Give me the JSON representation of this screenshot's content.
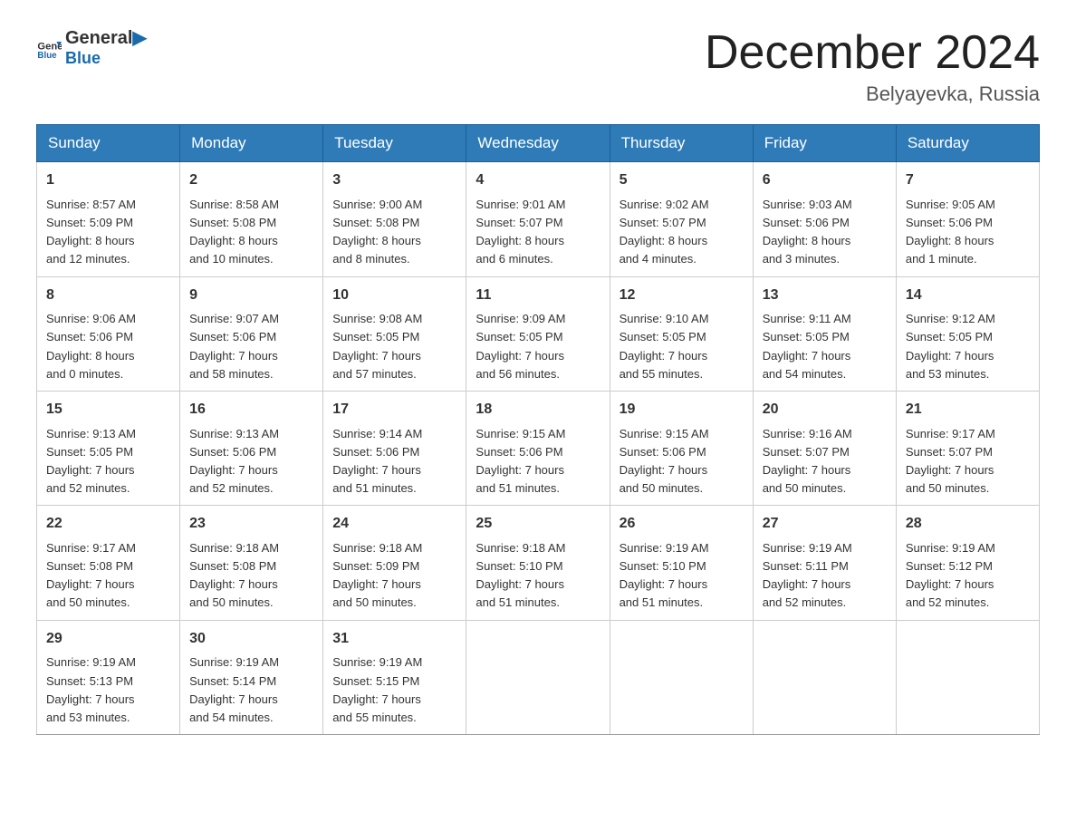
{
  "logo": {
    "text_general": "General",
    "text_blue": "Blue"
  },
  "title": "December 2024",
  "location": "Belyayevka, Russia",
  "days_of_week": [
    "Sunday",
    "Monday",
    "Tuesday",
    "Wednesday",
    "Thursday",
    "Friday",
    "Saturday"
  ],
  "weeks": [
    [
      {
        "day": "1",
        "info": "Sunrise: 8:57 AM\nSunset: 5:09 PM\nDaylight: 8 hours\nand 12 minutes."
      },
      {
        "day": "2",
        "info": "Sunrise: 8:58 AM\nSunset: 5:08 PM\nDaylight: 8 hours\nand 10 minutes."
      },
      {
        "day": "3",
        "info": "Sunrise: 9:00 AM\nSunset: 5:08 PM\nDaylight: 8 hours\nand 8 minutes."
      },
      {
        "day": "4",
        "info": "Sunrise: 9:01 AM\nSunset: 5:07 PM\nDaylight: 8 hours\nand 6 minutes."
      },
      {
        "day": "5",
        "info": "Sunrise: 9:02 AM\nSunset: 5:07 PM\nDaylight: 8 hours\nand 4 minutes."
      },
      {
        "day": "6",
        "info": "Sunrise: 9:03 AM\nSunset: 5:06 PM\nDaylight: 8 hours\nand 3 minutes."
      },
      {
        "day": "7",
        "info": "Sunrise: 9:05 AM\nSunset: 5:06 PM\nDaylight: 8 hours\nand 1 minute."
      }
    ],
    [
      {
        "day": "8",
        "info": "Sunrise: 9:06 AM\nSunset: 5:06 PM\nDaylight: 8 hours\nand 0 minutes."
      },
      {
        "day": "9",
        "info": "Sunrise: 9:07 AM\nSunset: 5:06 PM\nDaylight: 7 hours\nand 58 minutes."
      },
      {
        "day": "10",
        "info": "Sunrise: 9:08 AM\nSunset: 5:05 PM\nDaylight: 7 hours\nand 57 minutes."
      },
      {
        "day": "11",
        "info": "Sunrise: 9:09 AM\nSunset: 5:05 PM\nDaylight: 7 hours\nand 56 minutes."
      },
      {
        "day": "12",
        "info": "Sunrise: 9:10 AM\nSunset: 5:05 PM\nDaylight: 7 hours\nand 55 minutes."
      },
      {
        "day": "13",
        "info": "Sunrise: 9:11 AM\nSunset: 5:05 PM\nDaylight: 7 hours\nand 54 minutes."
      },
      {
        "day": "14",
        "info": "Sunrise: 9:12 AM\nSunset: 5:05 PM\nDaylight: 7 hours\nand 53 minutes."
      }
    ],
    [
      {
        "day": "15",
        "info": "Sunrise: 9:13 AM\nSunset: 5:05 PM\nDaylight: 7 hours\nand 52 minutes."
      },
      {
        "day": "16",
        "info": "Sunrise: 9:13 AM\nSunset: 5:06 PM\nDaylight: 7 hours\nand 52 minutes."
      },
      {
        "day": "17",
        "info": "Sunrise: 9:14 AM\nSunset: 5:06 PM\nDaylight: 7 hours\nand 51 minutes."
      },
      {
        "day": "18",
        "info": "Sunrise: 9:15 AM\nSunset: 5:06 PM\nDaylight: 7 hours\nand 51 minutes."
      },
      {
        "day": "19",
        "info": "Sunrise: 9:15 AM\nSunset: 5:06 PM\nDaylight: 7 hours\nand 50 minutes."
      },
      {
        "day": "20",
        "info": "Sunrise: 9:16 AM\nSunset: 5:07 PM\nDaylight: 7 hours\nand 50 minutes."
      },
      {
        "day": "21",
        "info": "Sunrise: 9:17 AM\nSunset: 5:07 PM\nDaylight: 7 hours\nand 50 minutes."
      }
    ],
    [
      {
        "day": "22",
        "info": "Sunrise: 9:17 AM\nSunset: 5:08 PM\nDaylight: 7 hours\nand 50 minutes."
      },
      {
        "day": "23",
        "info": "Sunrise: 9:18 AM\nSunset: 5:08 PM\nDaylight: 7 hours\nand 50 minutes."
      },
      {
        "day": "24",
        "info": "Sunrise: 9:18 AM\nSunset: 5:09 PM\nDaylight: 7 hours\nand 50 minutes."
      },
      {
        "day": "25",
        "info": "Sunrise: 9:18 AM\nSunset: 5:10 PM\nDaylight: 7 hours\nand 51 minutes."
      },
      {
        "day": "26",
        "info": "Sunrise: 9:19 AM\nSunset: 5:10 PM\nDaylight: 7 hours\nand 51 minutes."
      },
      {
        "day": "27",
        "info": "Sunrise: 9:19 AM\nSunset: 5:11 PM\nDaylight: 7 hours\nand 52 minutes."
      },
      {
        "day": "28",
        "info": "Sunrise: 9:19 AM\nSunset: 5:12 PM\nDaylight: 7 hours\nand 52 minutes."
      }
    ],
    [
      {
        "day": "29",
        "info": "Sunrise: 9:19 AM\nSunset: 5:13 PM\nDaylight: 7 hours\nand 53 minutes."
      },
      {
        "day": "30",
        "info": "Sunrise: 9:19 AM\nSunset: 5:14 PM\nDaylight: 7 hours\nand 54 minutes."
      },
      {
        "day": "31",
        "info": "Sunrise: 9:19 AM\nSunset: 5:15 PM\nDaylight: 7 hours\nand 55 minutes."
      },
      null,
      null,
      null,
      null
    ]
  ]
}
